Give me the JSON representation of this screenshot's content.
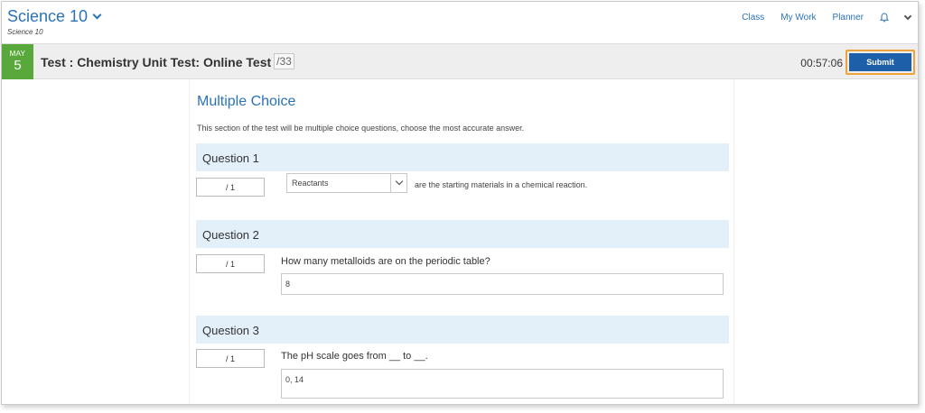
{
  "header": {
    "course_title": "Science 10",
    "course_subtitle": "Science 10",
    "nav": {
      "class": "Class",
      "my_work": "My Work",
      "planner": "Planner"
    }
  },
  "test": {
    "date_month": "MAY",
    "date_day": "5",
    "title": "Test : Chemistry Unit Test: Online Test",
    "total": "/33",
    "timer": "00:57:06",
    "submit_label": "Submit"
  },
  "section": {
    "title": "Multiple Choice",
    "description": "This section of the test will be multiple choice questions, choose the most accurate answer."
  },
  "questions": [
    {
      "heading": "Question 1",
      "score": "/ 1",
      "selected_option": "Reactants",
      "text_after": "are the starting materials in a chemical reaction."
    },
    {
      "heading": "Question 2",
      "score": "/ 1",
      "text": "How many metalloids are on the periodic table?",
      "answer": "8"
    },
    {
      "heading": "Question 3",
      "score": "/ 1",
      "text": "The pH scale goes from __ to __.",
      "answer": "0, 14"
    }
  ],
  "colors": {
    "link_blue": "#2a73b8",
    "date_green": "#58a83b",
    "submit_blue": "#1d5fa8",
    "submit_highlight": "#f0a23a",
    "question_bg": "#e3f0fa"
  },
  "icons": {
    "course_dropdown": "chevron-down-icon",
    "notifications": "bell-icon",
    "account_menu": "chevron-down-icon"
  }
}
